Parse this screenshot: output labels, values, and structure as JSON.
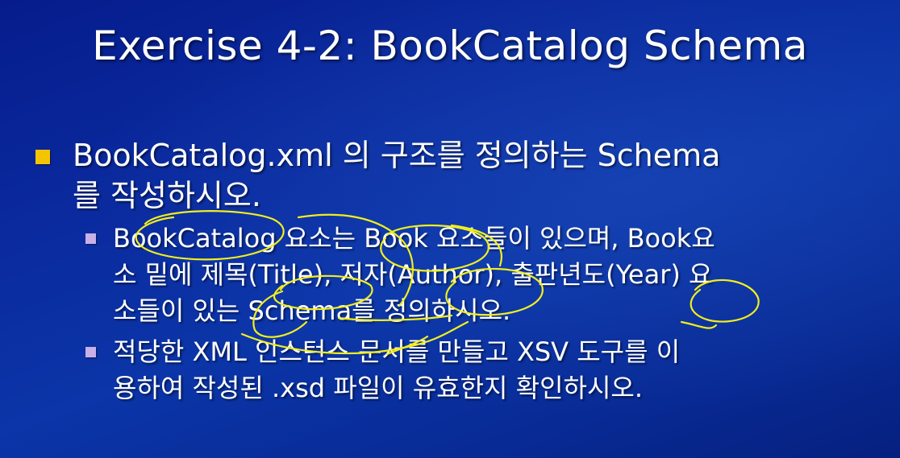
{
  "slide": {
    "title": "Exercise 4-2: BookCatalog Schema",
    "bullet1": {
      "line1": "BookCatalog.xml 의 구조를 정의하는 Schema",
      "line2": "를 작성하시오."
    },
    "sub1": {
      "line1": "BookCatalog 요소는 Book 요소들이 있으며, Book요",
      "line2": "소 밑에 제목(Title), 저자(Author), 출판년도(Year) 요",
      "line3": "소들이 있는 Schema를 정의하시오."
    },
    "sub2": {
      "line1": "적당한 XML 인스턴스 문서를 만들고 XSV 도구를 이",
      "line2": "용하여 작성된 .xsd 파일이 유효한지 확인하시오."
    }
  },
  "colors": {
    "background": "#0a2a9e",
    "bullet_level1": "#f5c400",
    "bullet_level2": "#c8b0e8",
    "annotation_ink": "#f2ee1c"
  }
}
